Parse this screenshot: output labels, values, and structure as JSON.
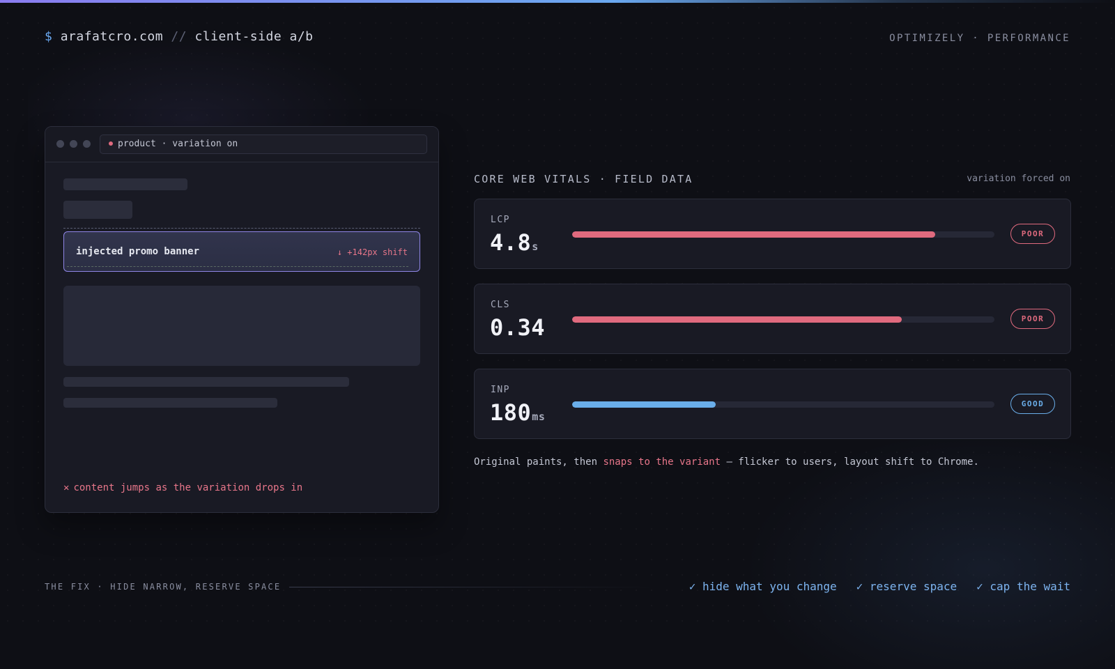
{
  "header": {
    "prompt": "$",
    "domain": "arafatcro.com",
    "separator": "//",
    "subtitle": "client-side a/b",
    "right_label": "OPTIMIZELY · PERFORMANCE"
  },
  "browser": {
    "url_text": "product · variation on",
    "banner_label": "injected promo banner",
    "banner_shift": "↓ +142px shift",
    "footer_icon": "✕",
    "footer_text": "content jumps as the variation drops in"
  },
  "vitals": {
    "title": "CORE WEB VITALS · FIELD DATA",
    "note": "variation forced on",
    "metrics": [
      {
        "label": "LCP",
        "value": "4.8",
        "unit": "s",
        "bar_fraction": 0.86,
        "status": "POOR",
        "color": "#e06a7e"
      },
      {
        "label": "CLS",
        "value": "0.34",
        "unit": "",
        "bar_fraction": 0.78,
        "status": "POOR",
        "color": "#e06a7e"
      },
      {
        "label": "INP",
        "value": "180",
        "unit": "ms",
        "bar_fraction": 0.34,
        "status": "GOOD",
        "color": "#6aaeea"
      }
    ],
    "caption_before": "Original paints, then ",
    "caption_highlight": "snaps to the variant",
    "caption_after": " — flicker to users, layout shift to Chrome."
  },
  "fix": {
    "title": "THE FIX · HIDE NARROW, RESERVE SPACE",
    "items": [
      "✓ hide what you change",
      "✓ reserve space",
      "✓ cap the wait"
    ]
  },
  "colors": {
    "accent": "#6aa8f0",
    "poor": "#e06a7e",
    "good": "#6aaeea",
    "banner_border": "#8f86e6"
  }
}
